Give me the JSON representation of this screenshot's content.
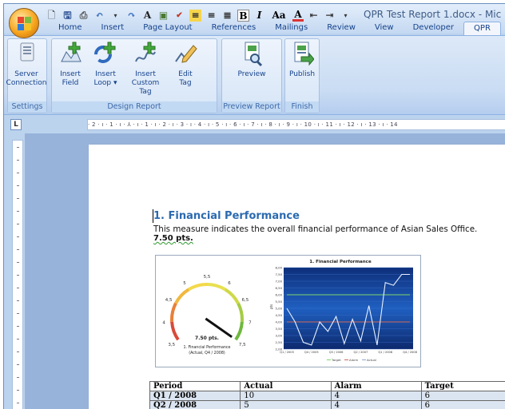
{
  "window": {
    "title": "QPR Test Report 1.docx - Mic"
  },
  "tabs": [
    "Home",
    "Insert",
    "Page Layout",
    "References",
    "Mailings",
    "Review",
    "View",
    "Developer",
    "QPR"
  ],
  "active_tab": "QPR",
  "ribbon": {
    "groups": [
      {
        "label": "Settings",
        "buttons": [
          {
            "label1": "Server",
            "label2": "Connection",
            "icon": "server-icon"
          }
        ]
      },
      {
        "label": "Design Report",
        "buttons": [
          {
            "label1": "Insert",
            "label2": "Field",
            "icon": "insert-field-icon"
          },
          {
            "label1": "Insert",
            "label2": "Loop ▾",
            "icon": "insert-loop-icon"
          },
          {
            "label1": "Insert",
            "label2": "Custom Tag",
            "icon": "insert-custom-tag-icon"
          },
          {
            "label1": "Edit",
            "label2": "Tag",
            "icon": "edit-tag-icon"
          }
        ]
      },
      {
        "label": "Preview Report",
        "buttons": [
          {
            "label1": "Preview",
            "label2": "",
            "icon": "preview-icon"
          }
        ]
      },
      {
        "label": "Finish",
        "buttons": [
          {
            "label1": "Publish",
            "label2": "",
            "icon": "publish-icon"
          }
        ]
      }
    ]
  },
  "ruler": {
    "text": "· 2 · ı · 1 · ı · ⅄ · ı · 1 · ı · 2 · ı · 3 · ı · 4 · ı · 5 · ı · 6 · ı · 7 · ı · 8 · ı · 9 · ı · 10 · ı · 11 · ı · 12 · ı · 13 · ı · 14"
  },
  "document": {
    "heading": "1. Financial Performance",
    "description": "This measure indicates the overall financial performance of Asian Sales Office.",
    "score": "7.50 pts.",
    "gauge": {
      "labels": [
        "3,5",
        "4",
        "4,5",
        "5",
        "5,5",
        "6",
        "6,5",
        "7",
        "7,5"
      ],
      "value": 7.5,
      "value_label": "7.50 pts.",
      "caption1": "1. Financial Performance",
      "caption2": "(Actual, Q4 / 2008)"
    },
    "chart_data": {
      "type": "line",
      "title": "1. Financial Performance",
      "ylabel": "pts",
      "x": [
        "Q1 / 2005",
        "Q4 / 2005",
        "Q3 / 2006",
        "Q2 / 2007",
        "Q1 / 2008",
        "Q4 / 2008"
      ],
      "yticks": [
        "2,00",
        "2,50",
        "3,00",
        "3,50",
        "4,00",
        "4,50",
        "5,00",
        "5,50",
        "6,00",
        "6,50",
        "7,00",
        "7,50",
        "8,00"
      ],
      "ylim": [
        2,
        8
      ],
      "series": [
        {
          "name": "Target",
          "color": "#7ed36a",
          "values": [
            6,
            6,
            6,
            6,
            6,
            6,
            6,
            6,
            6,
            6,
            6,
            6,
            6,
            6,
            6,
            6
          ]
        },
        {
          "name": "Alarm",
          "color": "#d06a5a",
          "values": [
            4,
            4,
            4,
            4,
            4,
            4,
            4,
            4,
            4,
            4,
            4,
            4,
            4,
            4,
            4,
            4
          ]
        },
        {
          "name": "Actual",
          "color": "#e6f0ff",
          "values": [
            5,
            4,
            2.5,
            2.3,
            4,
            3.3,
            4.4,
            2.4,
            4.2,
            2.6,
            5.2,
            2.3,
            6.9,
            6.7,
            7.5,
            7.5
          ]
        }
      ],
      "legend": "bottom"
    },
    "table": {
      "headers": [
        "Period",
        "Actual",
        "Alarm",
        "Target"
      ],
      "rows": [
        [
          "Q1 / 2008",
          "10",
          "4",
          "6"
        ],
        [
          "Q2 / 2008",
          "5",
          "4",
          "6"
        ]
      ]
    }
  },
  "colors": {
    "accent": "#2c6ab0",
    "ribbon": "#c9dcf3"
  }
}
